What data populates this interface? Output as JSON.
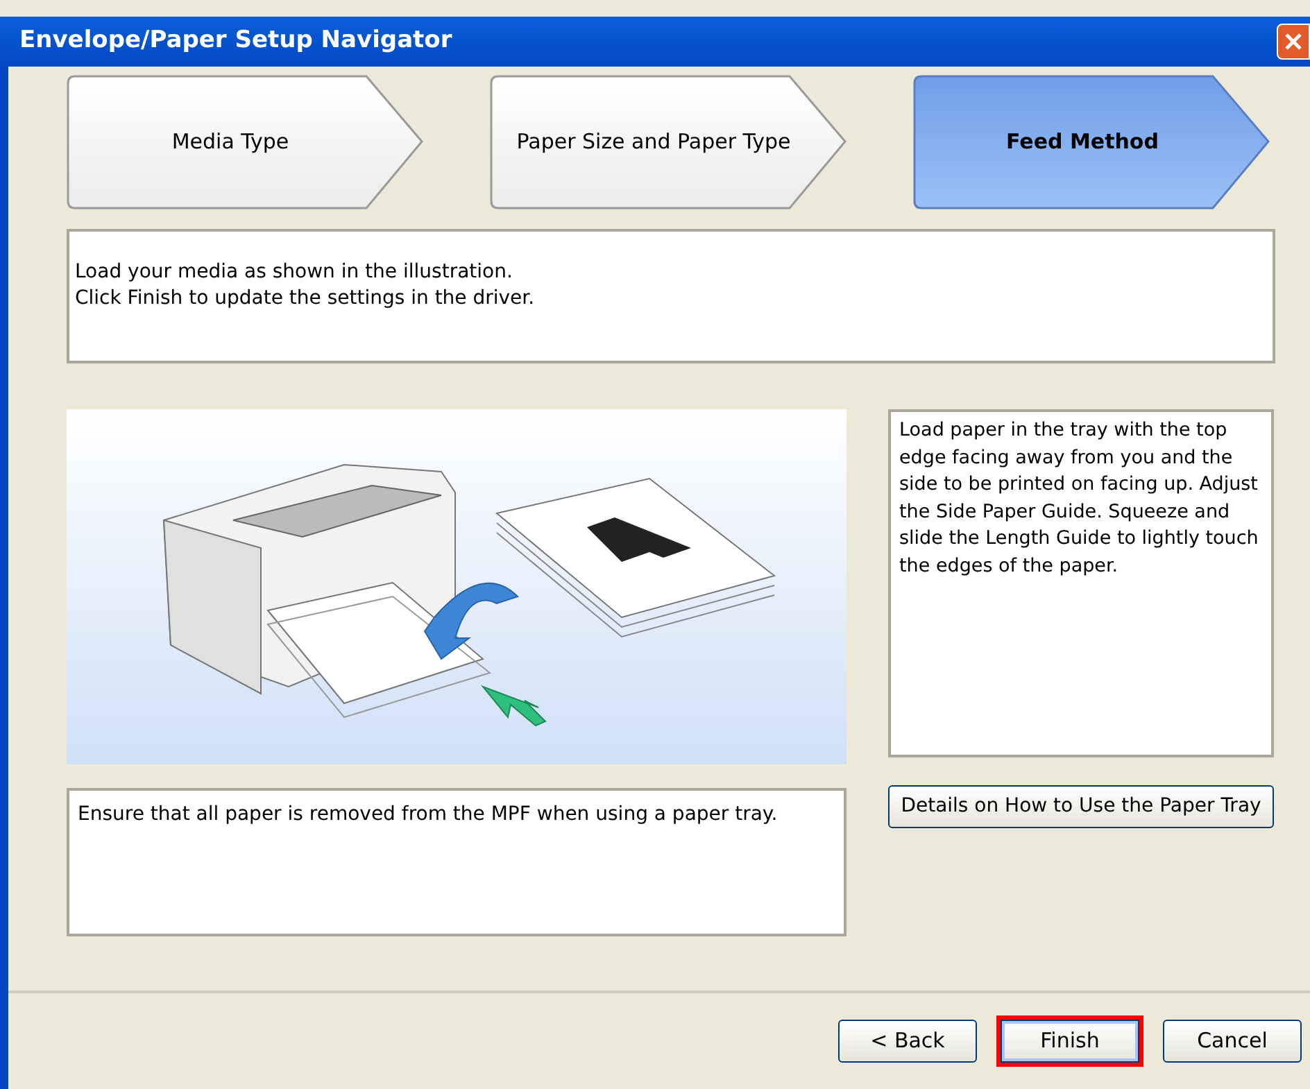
{
  "window": {
    "title": "Envelope/Paper Setup Navigator"
  },
  "steps": [
    {
      "label": "Media Type",
      "selected": false
    },
    {
      "label": "Paper Size and Paper Type",
      "selected": false
    },
    {
      "label": "Feed Method",
      "selected": true
    }
  ],
  "instructions": [
    "Load your media as shown in the illustration.",
    "Click Finish to update the settings in the driver."
  ],
  "description": "Load paper in the tray with the top edge facing away from you and the side to be printed on facing up. Adjust the Side Paper Guide. Squeeze and slide the Length Guide to lightly touch the edges of the paper.",
  "details_button": "Details on How to Use the Paper Tray",
  "note": "Ensure that all paper is removed from the MPF when using a paper tray.",
  "buttons": [
    {
      "label": "< Back",
      "highlighted": false
    },
    {
      "label": "Finish",
      "highlighted": true
    },
    {
      "label": "Cancel",
      "highlighted": false
    }
  ]
}
